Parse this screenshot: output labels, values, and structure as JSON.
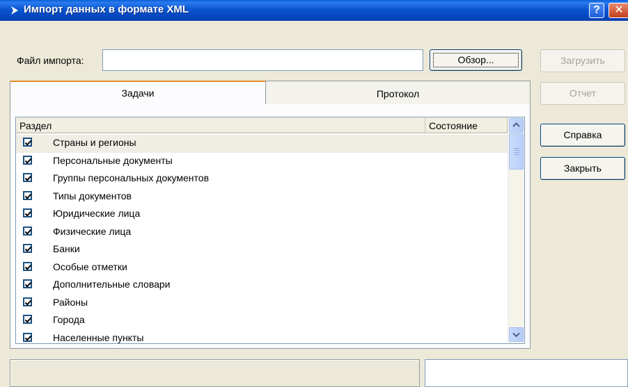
{
  "window": {
    "title": "Импорт данных в формате XML",
    "help_button": "?",
    "close_button": "✕"
  },
  "file": {
    "label": "Файл импорта:",
    "value": "",
    "browse_label": "Обзор..."
  },
  "side_buttons": {
    "load": "Загрузить",
    "report": "Отчет",
    "help": "Справка",
    "close": "Закрыть"
  },
  "tabs": [
    {
      "label": "Задачи",
      "active": true
    },
    {
      "label": "Протокол",
      "active": false
    }
  ],
  "list": {
    "columns": [
      "Раздел",
      "Состояние"
    ],
    "items": [
      {
        "label": "Страны и регионы",
        "checked": true,
        "selected": true
      },
      {
        "label": "Персональные документы",
        "checked": true
      },
      {
        "label": "Группы персональных документов",
        "checked": true
      },
      {
        "label": "Типы документов",
        "checked": true
      },
      {
        "label": "Юридические лица",
        "checked": true
      },
      {
        "label": "Физические лица",
        "checked": true
      },
      {
        "label": "Банки",
        "checked": true
      },
      {
        "label": "Особые отметки",
        "checked": true
      },
      {
        "label": "Дополнительные словари",
        "checked": true
      },
      {
        "label": "Районы",
        "checked": true
      },
      {
        "label": "Города",
        "checked": true
      },
      {
        "label": "Населенные пункты",
        "checked": true
      }
    ]
  },
  "colors": {
    "titlebar": "#0a55cf",
    "face": "#ece9d8",
    "border": "#7f9db9",
    "tab_accent": "#e68b2c"
  }
}
